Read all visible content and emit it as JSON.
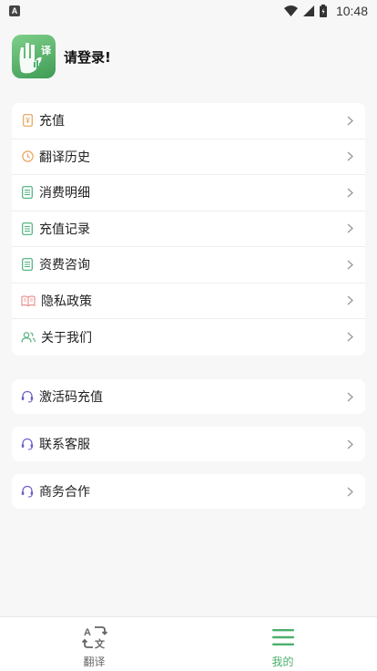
{
  "status_bar": {
    "notification_badge": "A",
    "time": "10:48"
  },
  "profile": {
    "avatar_badge": "译",
    "login_prompt": "请登录!"
  },
  "menu_main": [
    {
      "label": "充值",
      "icon": "wallet-icon"
    },
    {
      "label": "翻译历史",
      "icon": "clock-icon"
    },
    {
      "label": "消费明细",
      "icon": "list-icon"
    },
    {
      "label": "充值记录",
      "icon": "list-icon"
    },
    {
      "label": "资费咨询",
      "icon": "list-icon"
    },
    {
      "label": "隐私政策",
      "icon": "book-icon"
    },
    {
      "label": "关于我们",
      "icon": "users-icon"
    }
  ],
  "menu_secondary": [
    {
      "label": "激活码充值",
      "icon": "headset-icon"
    },
    {
      "label": "联系客服",
      "icon": "headset-icon"
    },
    {
      "label": "商务合作",
      "icon": "headset-icon"
    }
  ],
  "tabs": [
    {
      "label": "翻译",
      "active": false,
      "icon": "translate-icon"
    },
    {
      "label": "我的",
      "active": true,
      "icon": "menu-icon"
    }
  ],
  "colors": {
    "accent_green": "#4caf6e",
    "tab_inactive": "#666666",
    "orange": "#e8a35a",
    "green_icon": "#4caf7a",
    "pink": "#e88a8a",
    "purple": "#6a5fc8"
  }
}
